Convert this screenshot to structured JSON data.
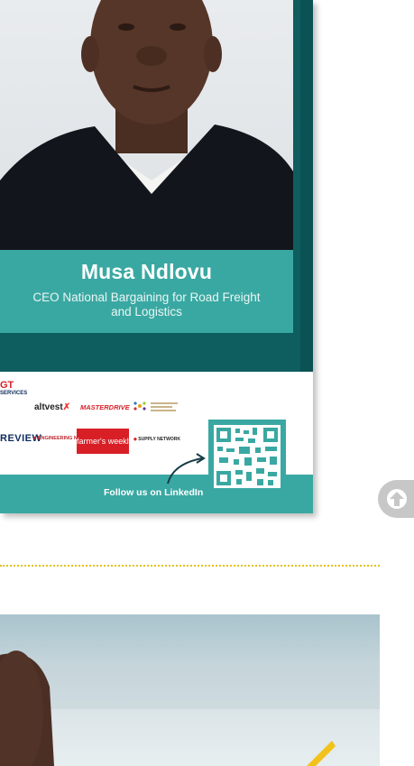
{
  "poster": {
    "name": "Musa Ndlovu",
    "role": "CEO National Bargaining for Road Freight and Logistics",
    "follow_text": "Follow us on LinkedIn",
    "logos": {
      "services": "SERVICES",
      "review": "REVIEW",
      "altvest": "altvest",
      "masterdrive": "MASTERDRIVE",
      "engineering_news": "ENGINEERING NEWS",
      "farmers_weekly": "farmer's weekly",
      "supply_network": "SUPPLY NETWORK"
    }
  },
  "colors": {
    "teal_dark": "#0e5d5f",
    "teal_light": "#3aa8a2",
    "divider": "#e2c21a",
    "scroll_button": "#c7c7c7"
  },
  "icons": {
    "scroll_top": "arrow-up-icon",
    "qr": "qr-code-icon",
    "follow_arrow": "curved-arrow-icon"
  }
}
